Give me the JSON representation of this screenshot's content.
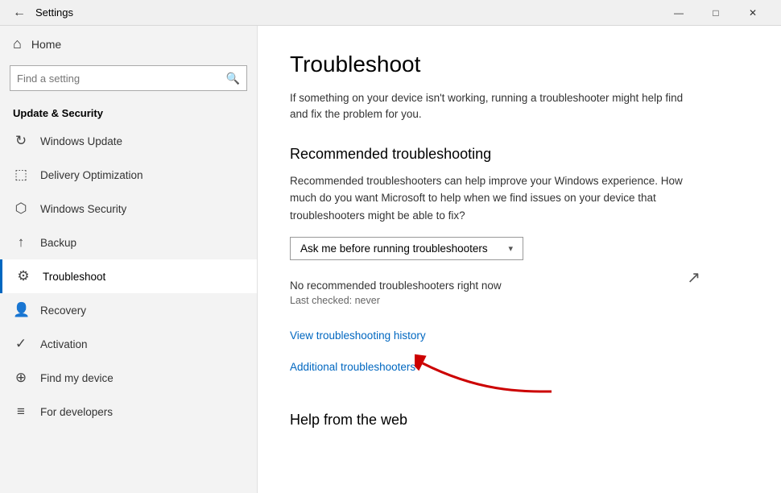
{
  "titleBar": {
    "title": "Settings",
    "backLabel": "←",
    "minimizeLabel": "—",
    "maximizeLabel": "□",
    "closeLabel": "✕"
  },
  "sidebar": {
    "homeLabel": "Home",
    "searchPlaceholder": "Find a setting",
    "sectionTitle": "Update & Security",
    "items": [
      {
        "id": "windows-update",
        "label": "Windows Update",
        "icon": "↻"
      },
      {
        "id": "delivery-optimization",
        "label": "Delivery Optimization",
        "icon": "↕"
      },
      {
        "id": "windows-security",
        "label": "Windows Security",
        "icon": "⬡"
      },
      {
        "id": "backup",
        "label": "Backup",
        "icon": "↑"
      },
      {
        "id": "troubleshoot",
        "label": "Troubleshoot",
        "icon": "⚙"
      },
      {
        "id": "recovery",
        "label": "Recovery",
        "icon": "👤"
      },
      {
        "id": "activation",
        "label": "Activation",
        "icon": "✓"
      },
      {
        "id": "find-my-device",
        "label": "Find my device",
        "icon": "⊕"
      },
      {
        "id": "for-developers",
        "label": "For developers",
        "icon": "≡"
      }
    ]
  },
  "content": {
    "title": "Troubleshoot",
    "description": "If something on your device isn't working, running a troubleshooter might help find and fix the problem for you.",
    "recommendedSection": {
      "heading": "Recommended troubleshooting",
      "description": "Recommended troubleshooters can help improve your Windows experience. How much do you want Microsoft to help when we find issues on your device that troubleshooters might be able to fix?",
      "dropdownValue": "Ask me before running troubleshooters",
      "dropdownChevron": "▾",
      "noTroubleshooters": "No recommended troubleshooters right now",
      "lastChecked": "Last checked: never"
    },
    "viewHistoryLink": "View troubleshooting history",
    "additionalLink": "Additional troubleshooters",
    "helpSection": {
      "heading": "Help from the web"
    }
  }
}
